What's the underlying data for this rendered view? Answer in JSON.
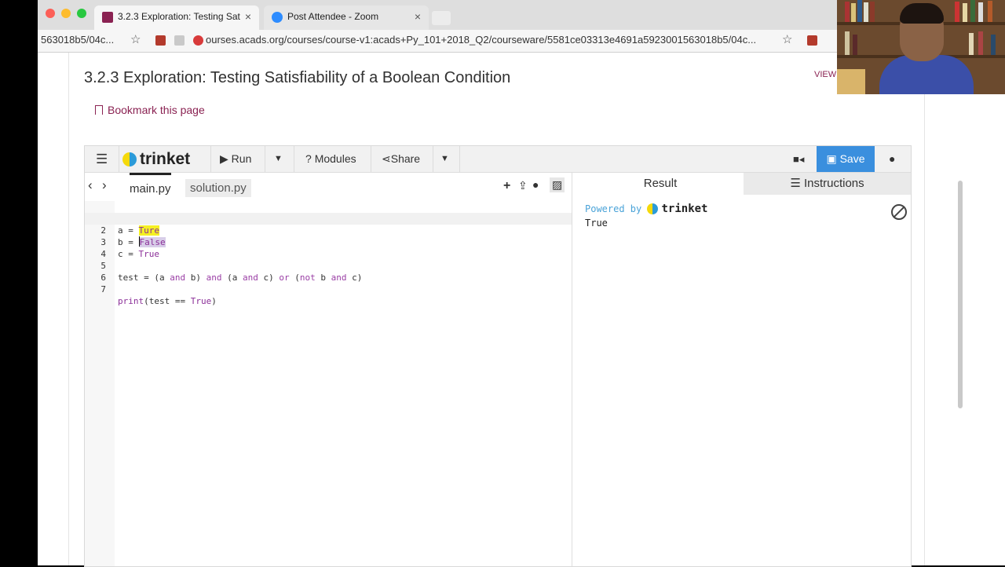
{
  "browser": {
    "tabs": [
      {
        "title": "3.2.3 Exploration: Testing Sati",
        "active": true,
        "close": "×"
      },
      {
        "title": "Post Attendee - Zoom",
        "active": false,
        "close": "×"
      }
    ],
    "address": {
      "left_fragment": "563018b5/04c...",
      "url": "ourses.acads.org/courses/course-v1:acads+Py_101+2018_Q2/courseware/5581ce03313e4691a5923001563018b5/04c...",
      "badge_count": "12"
    }
  },
  "page": {
    "title": "3.2.3 Exploration: Testing Satisfiability of a Boolean Condition",
    "view_label": "VIEW",
    "bookmark_label": "Bookmark this page"
  },
  "trinket": {
    "toolbar": {
      "brand": "trinket",
      "run": "Run",
      "modules": "Modules",
      "share": "Share",
      "save": "Save"
    },
    "editor_tabs": [
      "main.py",
      "solution.py"
    ],
    "code": [
      {
        "n": "1",
        "text": "a = Ture"
      },
      {
        "n": "2",
        "text": "b = False"
      },
      {
        "n": "3",
        "text": "c = True"
      },
      {
        "n": "4",
        "text": ""
      },
      {
        "n": "5",
        "text": "test = (a and b) and (a and c) or (not b and c)"
      },
      {
        "n": "6",
        "text": ""
      },
      {
        "n": "7",
        "text": "print(test == True)"
      }
    ],
    "result_tabs": {
      "result": "Result",
      "instructions": "Instructions"
    },
    "powered_by": "Powered by",
    "output": "True"
  }
}
